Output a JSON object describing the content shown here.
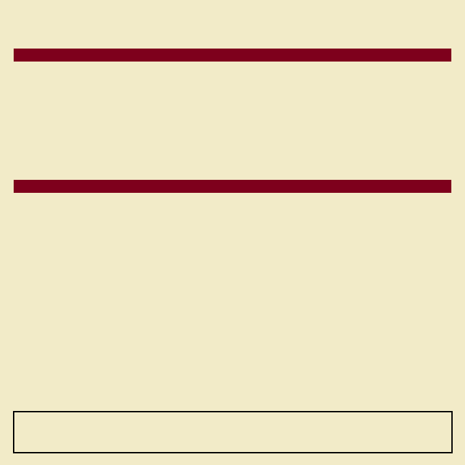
{
  "colors": {
    "background": "#F2EBC8",
    "bar": "#7E001C",
    "box_border": "#000000"
  }
}
